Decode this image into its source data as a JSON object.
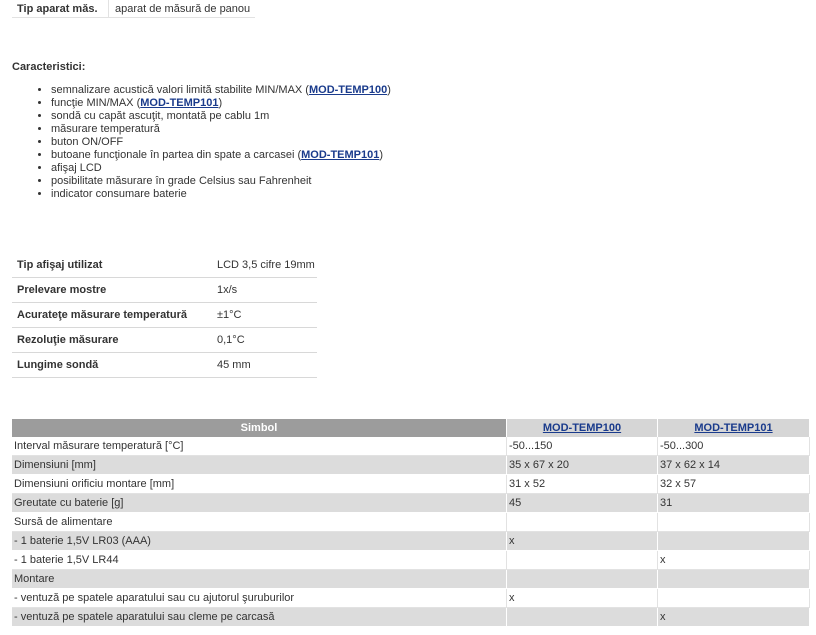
{
  "top_row": {
    "label": "Tip aparat măs.",
    "value": "aparat de măsură de panou"
  },
  "features": {
    "heading": "Caracteristici:",
    "items": [
      {
        "text": "semnalizare acustică valori limită stabilite MIN/MAX (",
        "link": "MOD-TEMP100",
        "after": ")"
      },
      {
        "text": "funcţie MIN/MAX (",
        "link": "MOD-TEMP101",
        "after": ")"
      },
      {
        "text": "sondă cu capăt ascuţit, montată pe cablu 1m"
      },
      {
        "text": "măsurare temperatură"
      },
      {
        "text": "buton ON/OFF"
      },
      {
        "text": "butoane funcţionale în partea din spate a carcasei (",
        "link": "MOD-TEMP101",
        "after": ")"
      },
      {
        "text": "afişaj LCD"
      },
      {
        "text": "posibilitate măsurare în grade Celsius sau Fahrenheit"
      },
      {
        "text": "indicator consumare baterie"
      }
    ]
  },
  "specs": [
    {
      "label": "Tip afişaj utilizat",
      "value": "LCD 3,5 cifre 19mm"
    },
    {
      "label": "Prelevare mostre",
      "value": "1x/s"
    },
    {
      "label": "Acurateţe măsurare temperatură",
      "value": "±1°C"
    },
    {
      "label": "Rezoluţie măsurare",
      "value": "0,1°C"
    },
    {
      "label": "Lungime sondă",
      "value": "45 mm"
    }
  ],
  "comparison": {
    "headers": [
      "Simbol",
      "MOD-TEMP100",
      "MOD-TEMP101"
    ],
    "rows": [
      [
        "Interval măsurare temperatură [°C]",
        "-50...150",
        "-50...300"
      ],
      [
        "Dimensiuni [mm]",
        "35 x 67 x 20",
        "37 x 62 x 14"
      ],
      [
        "Dimensiuni orificiu montare [mm]",
        "31 x 52",
        "32 x 57"
      ],
      [
        "Greutate cu baterie [g]",
        "45",
        "31"
      ],
      [
        "Sursă de alimentare",
        "",
        ""
      ],
      [
        "- 1 baterie 1,5V LR03 (AAA)",
        "x",
        ""
      ],
      [
        "- 1 baterie 1,5V LR44",
        "",
        "x"
      ],
      [
        "Montare",
        "",
        ""
      ],
      [
        "- ventuză pe spatele aparatului sau cu ajutorul şuruburilor",
        "x",
        ""
      ],
      [
        "- ventuză pe spatele aparatului sau cleme pe carcasă",
        "",
        "x"
      ]
    ]
  },
  "colors": {
    "link": "#1a3b8c",
    "header_dark": "#9c9c9c",
    "header_light": "#d6d6d6",
    "row_alt": "#dcdcdc"
  }
}
